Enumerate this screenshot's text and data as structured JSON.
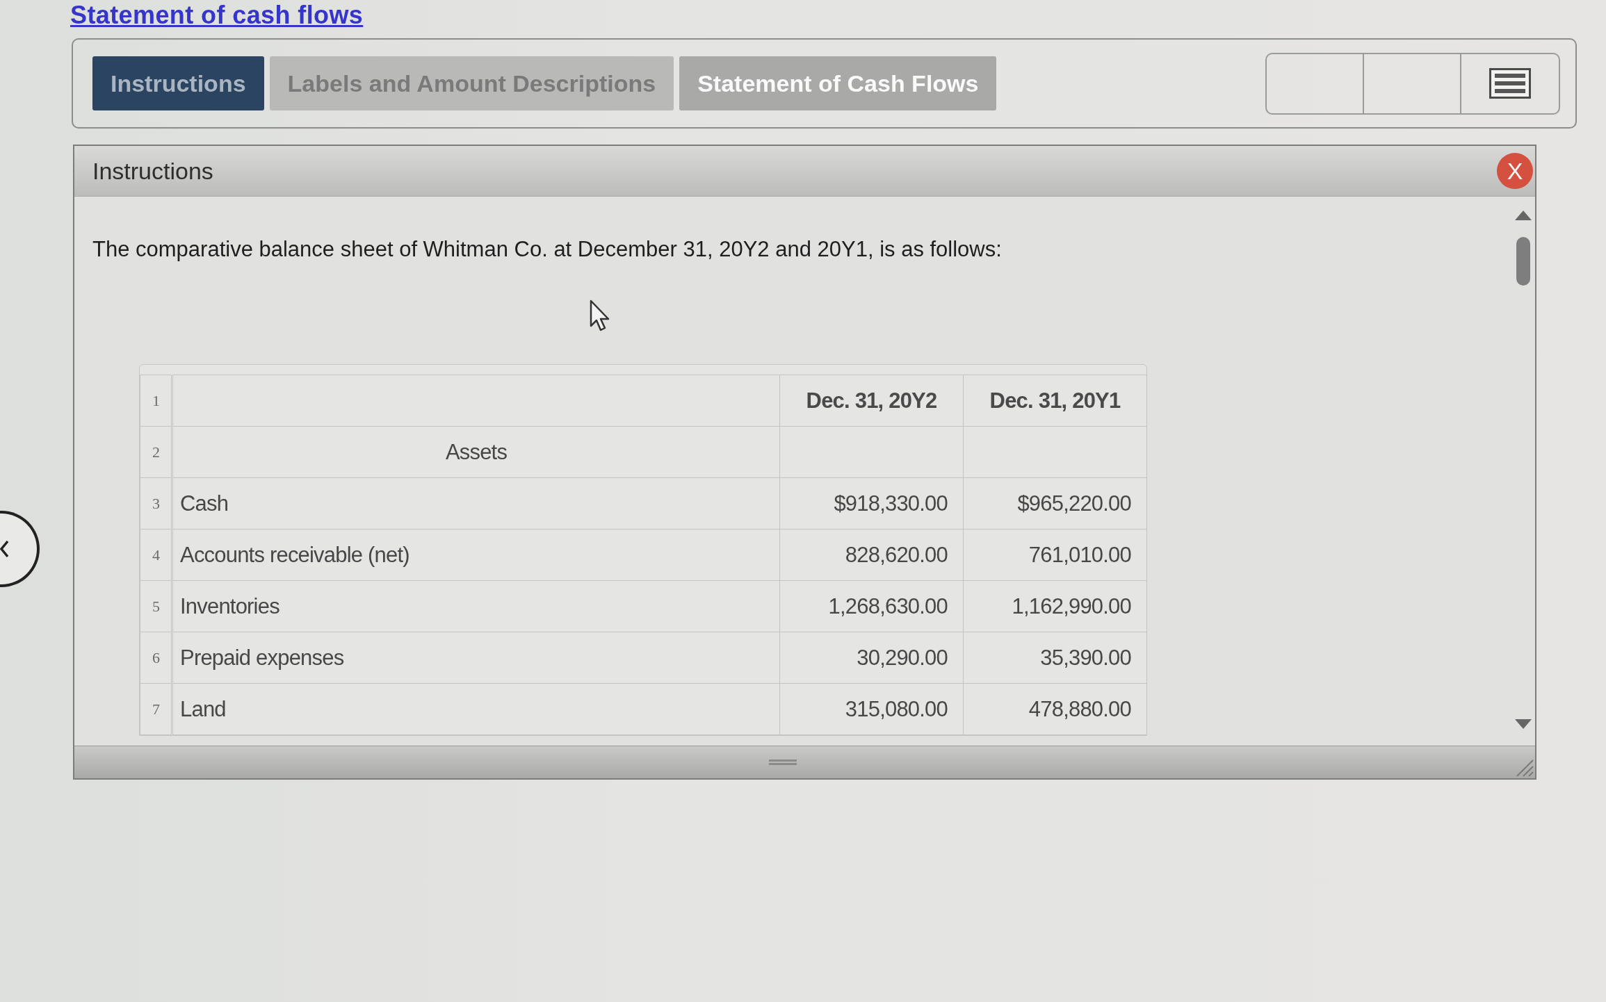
{
  "page_link": {
    "label": "Statement of cash flows"
  },
  "tabs": [
    {
      "label": "Instructions",
      "selected": true,
      "disabled": false
    },
    {
      "label": "Labels and Amount Descriptions",
      "selected": false,
      "disabled": true
    },
    {
      "label": "Statement of Cash Flows",
      "selected": false,
      "disabled": false
    }
  ],
  "panel": {
    "title": "Instructions",
    "close_button": "X",
    "intro": "The comparative balance sheet of Whitman Co. at December 31, 20Y2 and 20Y1, is as follows:",
    "table": {
      "rows": [
        {
          "number": "1",
          "kind": "column_heading",
          "values": [
            "Dec. 31, 20Y2",
            "Dec. 31, 20Y1"
          ]
        },
        {
          "number": "2",
          "kind": "section",
          "label": "Assets"
        },
        {
          "number": "3",
          "kind": "item",
          "label": "Cash",
          "values": [
            "$918,330.00",
            "$965,220.00"
          ]
        },
        {
          "number": "4",
          "kind": "item",
          "label": "Accounts receivable (net)",
          "values": [
            "828,620.00",
            "761,010.00"
          ]
        },
        {
          "number": "5",
          "kind": "item",
          "label": "Inventories",
          "values": [
            "1,268,630.00",
            "1,162,990.00"
          ]
        },
        {
          "number": "6",
          "kind": "item",
          "label": "Prepaid expenses",
          "values": [
            "30,290.00",
            "35,390.00"
          ]
        },
        {
          "number": "7",
          "kind": "item",
          "label": "Land",
          "values": [
            "315,080.00",
            "478,880.00"
          ]
        }
      ]
    }
  }
}
